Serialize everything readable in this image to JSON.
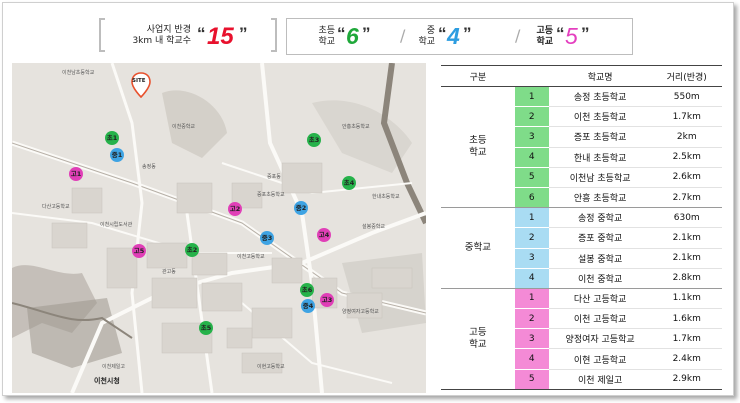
{
  "header": {
    "summary_line1": "사업지 반경",
    "summary_line2": "3km 내 학교수",
    "total": "15",
    "elem_line1": "초등",
    "elem_line2": "학교",
    "elem_count": "6",
    "mid_line1": "중",
    "mid_line2": "학교",
    "mid_count": "4",
    "high_line1": "고등",
    "high_line2": "학교",
    "high_count": "5",
    "colors": {
      "total": "#e8112d",
      "elem": "#1fa83a",
      "mid": "#2d9de0",
      "high": "#e43fbf"
    }
  },
  "map": {
    "site_label": "SITE",
    "bottom_label": "이천시청",
    "pins": [
      {
        "label": "초1",
        "type": "e"
      },
      {
        "label": "중1",
        "type": "m"
      },
      {
        "label": "고1",
        "type": "h"
      },
      {
        "label": "초3",
        "type": "e"
      },
      {
        "label": "초4",
        "type": "e"
      },
      {
        "label": "고2",
        "type": "h"
      },
      {
        "label": "중2",
        "type": "m"
      },
      {
        "label": "중3",
        "type": "m"
      },
      {
        "label": "고4",
        "type": "h"
      },
      {
        "label": "고3",
        "type": "h"
      },
      {
        "label": "초2",
        "type": "e"
      },
      {
        "label": "초6",
        "type": "e"
      },
      {
        "label": "중4",
        "type": "m"
      },
      {
        "label": "고5",
        "type": "h"
      },
      {
        "label": "초5",
        "type": "e"
      }
    ],
    "place_labels": [
      "이천남초등학교",
      "이천중학교",
      "이천시립도서관",
      "이천시청",
      "안흥초등학교",
      "이천고등학교",
      "증포동",
      "송정동",
      "관고동",
      "다산고등학교",
      "설봉중학교",
      "양정여자고등학교",
      "이현고등학교",
      "이천제일고",
      "증포초등학교",
      "한내초등학교"
    ]
  },
  "table": {
    "headers": [
      "구분",
      "학교명",
      "거리(반경)"
    ],
    "groups": [
      {
        "name_line1": "초등",
        "name_line2": "학교",
        "color_class": "c-e",
        "rows": [
          {
            "num": "1",
            "name": "송정 초등학교",
            "dist": "550m"
          },
          {
            "num": "2",
            "name": "이천 초등학교",
            "dist": "1.7km"
          },
          {
            "num": "3",
            "name": "증포 초등학교",
            "dist": "2km"
          },
          {
            "num": "4",
            "name": "한내 초등학교",
            "dist": "2.5km"
          },
          {
            "num": "5",
            "name": "이천남 초등학교",
            "dist": "2.6km"
          },
          {
            "num": "6",
            "name": "안흥 초등학교",
            "dist": "2.7km"
          }
        ]
      },
      {
        "name_line1": "중학교",
        "name_line2": "",
        "color_class": "c-m",
        "rows": [
          {
            "num": "1",
            "name": "송정 중학교",
            "dist": "630m"
          },
          {
            "num": "2",
            "name": "증포 중학교",
            "dist": "2.1km"
          },
          {
            "num": "3",
            "name": "설봉 중학교",
            "dist": "2.1km"
          },
          {
            "num": "4",
            "name": "이천 중학교",
            "dist": "2.8km"
          }
        ]
      },
      {
        "name_line1": "고등",
        "name_line2": "학교",
        "color_class": "c-h",
        "rows": [
          {
            "num": "1",
            "name": "다산 고등학교",
            "dist": "1.1km"
          },
          {
            "num": "2",
            "name": "이천 고등학교",
            "dist": "1.6km"
          },
          {
            "num": "3",
            "name": "양정여자 고등학교",
            "dist": "1.7km"
          },
          {
            "num": "4",
            "name": "이현 고등학교",
            "dist": "2.4km"
          },
          {
            "num": "5",
            "name": "이천 제일고",
            "dist": "2.9km"
          }
        ]
      }
    ]
  }
}
